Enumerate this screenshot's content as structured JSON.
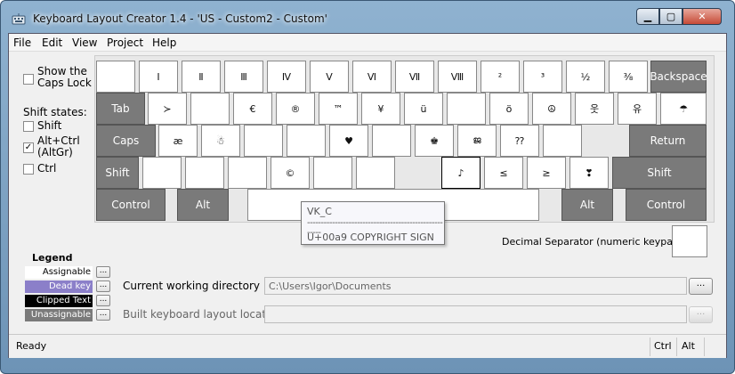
{
  "window": {
    "title": "Keyboard Layout Creator 1.4 - 'US - Custom2 - Custom'"
  },
  "menu": [
    "File",
    "Edit",
    "View",
    "Project",
    "Help"
  ],
  "options": {
    "show_caps": "Show the\nCaps Lock",
    "shift_states_title": "Shift states:",
    "shift": "Shift",
    "altctrl": "Alt+Ctrl\n(AltGr)",
    "ctrl": "Ctrl",
    "show_caps_checked": false,
    "shift_checked": false,
    "altctrl_checked": true,
    "ctrl_checked": false
  },
  "keys": {
    "row1": [
      "",
      "Ⅰ",
      "Ⅱ",
      "Ⅲ",
      "Ⅳ",
      "Ⅴ",
      "Ⅵ",
      "Ⅶ",
      "Ⅷ",
      "²",
      "³",
      "½",
      "⅜",
      "Backspace"
    ],
    "row2": [
      "Tab",
      "≻",
      "",
      "€",
      "®",
      "™",
      "¥",
      "ü",
      "",
      "ö",
      "☮",
      "웃",
      "유",
      "☂"
    ],
    "row3": [
      "Caps",
      "æ",
      "☃",
      "",
      "",
      "♥",
      "",
      "♚",
      "ജ",
      "⁇",
      "",
      "Return"
    ],
    "row4": [
      "Shift",
      "",
      "",
      "",
      "©",
      "",
      "",
      "♪",
      "≤",
      "≥",
      "❣",
      "Shift"
    ],
    "row5": [
      "Control",
      "Alt",
      "",
      "Alt",
      "Control"
    ]
  },
  "tooltip": {
    "vk": "VK_C",
    "sep": "------------------------------------------------------",
    "code": "U+00a9   COPYRIGHT SIGN"
  },
  "decimal_separator_label": "Decimal Separator (numeric keypad)",
  "legend": {
    "title": "Legend",
    "browse": "...",
    "items": [
      {
        "label": "Assignable",
        "color": "#ffffff"
      },
      {
        "label": "Dead key",
        "color": "#8b7fc9"
      },
      {
        "label": "Clipped Text",
        "color": "#000000"
      },
      {
        "label": "Unassignable",
        "color": "#7a7a7a"
      }
    ]
  },
  "cwd": {
    "label": "Current working directory",
    "value": "C:\\Users\\Igor\\Documents"
  },
  "build": {
    "label": "Built keyboard layout location",
    "value": ""
  },
  "status": {
    "text": "Ready",
    "ctrl": "Ctrl",
    "alt": "Alt"
  }
}
